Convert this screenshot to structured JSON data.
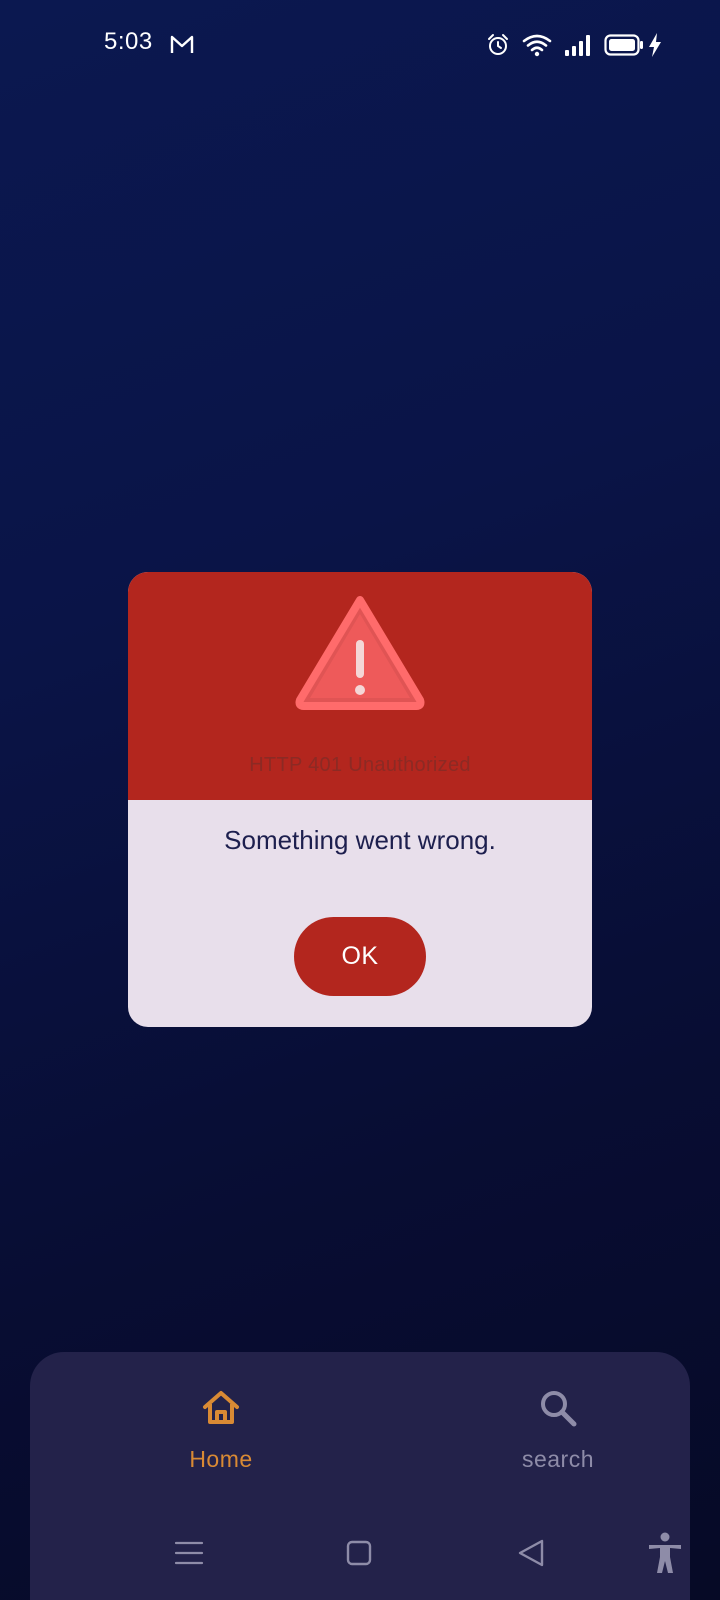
{
  "status_bar": {
    "time": "5:03",
    "notification_icon": "gmail-icon",
    "right_icons": [
      "alarm-icon",
      "wifi-icon",
      "signal-icon",
      "battery-icon",
      "charging-icon"
    ]
  },
  "dialog": {
    "icon": "warning-icon",
    "subtitle": "HTTP 401 Unauthorized",
    "message": "Something went wrong.",
    "ok_label": "OK"
  },
  "bottom_nav": {
    "items": [
      {
        "label": "Home",
        "icon": "home-icon",
        "active": true
      },
      {
        "label": "search",
        "icon": "search-icon",
        "active": false
      }
    ]
  },
  "system_nav": [
    "menu-icon",
    "home-square-icon",
    "back-icon",
    "accessibility-icon"
  ],
  "colors": {
    "background": "#0a1447",
    "dialog_header": "#b3261e",
    "dialog_body": "#e8dfeb",
    "nav_background": "#23224a",
    "nav_active": "#d98a34",
    "nav_inactive": "#8e8ca8"
  }
}
